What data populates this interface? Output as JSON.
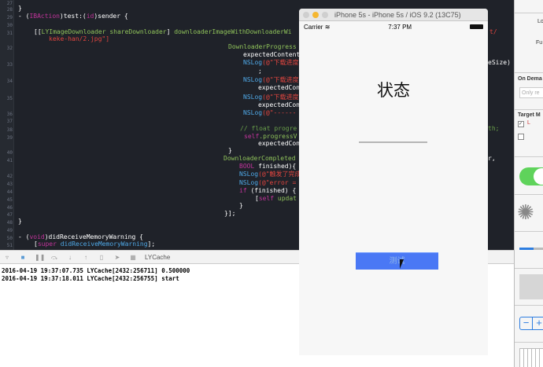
{
  "editor": {
    "line_numbers": [
      "27",
      "28",
      "29",
      "30",
      "31",
      "32",
      "33",
      "34",
      "35",
      "36",
      "37",
      "38",
      "39",
      "40",
      "41",
      "42",
      "43",
      "44",
      "45",
      "46",
      "47",
      "48",
      "49",
      "50",
      "51"
    ],
    "right_fragments": [
      "t/",
      "eSize)",
      "th;",
      "r,"
    ]
  },
  "code": {
    "l28": "}",
    "l29a": "- (",
    "l29b": "IBAction",
    "l29c": ")test:(",
    "l29d": "id",
    "l29e": ")sender {",
    "l31a": "[[",
    "l31b": "LYImageDownloader shareDownloader",
    "l31c": "] ",
    "l31d": "downloaderImageWithDownloaderWi",
    "l31e": "keke-han/2.jpg\"]",
    "l32": "DownloaderProgress",
    "l32b": "expectedContent",
    "l33a": "NSLog",
    "l33b": "(@\"下载进度",
    "l33c": ";",
    "l34a": "NSLog",
    "l34b": "(@\"下载进度",
    "l34c": "expectedCon",
    "l35a": "NSLog",
    "l35b": "(@\"下载进度",
    "l35c": "expectedCon",
    "l36a": "NSLog",
    "l36b": "(@\"------",
    "l38": "// float progre",
    "l39a": "self",
    "l39b": ".progressV",
    "l39c": "expectedCon",
    "l40": "}",
    "l41": "DownloaderCompleted",
    "l41a": "BOOL",
    "l41b": " finished){",
    "l42a": "NSLog",
    "l42b": "(@\"触发了完成",
    "l43a": "NSLog",
    "l43b": "(@\"error =",
    "l44a": "if",
    "l44b": " (finished) {",
    "l45a": "[",
    "l45b": "self",
    "l45c": " updat",
    "l46": "}",
    "l47": "}];",
    "l48": "}",
    "l50a": "- (",
    "l50b": "void",
    "l50c": ")didReceiveMemoryWarning {",
    "l51a": "[",
    "l51b": "super",
    "l51c": " didReceiveMemoryWarning",
    "l51d": "];"
  },
  "debug_bar": {
    "target": "LYCache"
  },
  "console": {
    "lines": [
      "2016-04-19 19:37:07.735 LYCache[2432:256711] 0.500000",
      "2016-04-19 19:37:18.011 LYCache[2432:256755] start"
    ]
  },
  "simulator": {
    "title": "iPhone 5s - iPhone 5s / iOS 9.2 (13C75)",
    "carrier": "Carrier",
    "time": "7:37 PM",
    "status_label": "状态",
    "progress": 0,
    "button": "测试",
    "button_color": "#4a78f5"
  },
  "sidebar": {
    "lo": "Lo",
    "fu": "Fu",
    "on_demand": "On Dema",
    "only": "Only re",
    "target": "Target M",
    "item": "L",
    "switch_on": true,
    "progress": 0.4
  }
}
